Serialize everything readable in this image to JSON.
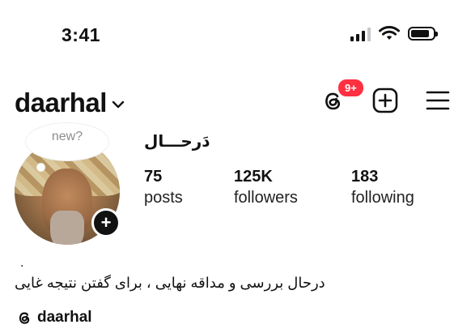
{
  "status_bar": {
    "time": "3:41",
    "icons": [
      "cellular-signal-icon",
      "wifi-icon",
      "battery-icon"
    ]
  },
  "header": {
    "username": "daarhal",
    "threads_badge": "9+",
    "icons": [
      "threads-icon",
      "add-post-icon",
      "menu-icon"
    ],
    "badge_color": "#ff3040"
  },
  "profile": {
    "note": "new?",
    "display_name": "دَرحـــال",
    "stats": [
      {
        "value": "75",
        "label": "posts"
      },
      {
        "value": "125K",
        "label": "followers"
      },
      {
        "value": "183",
        "label": "following"
      }
    ],
    "bio_dot": ".",
    "bio": "درحال بررسی و مداقه نهایی ، برای گفتن نتیجه غایی",
    "threads_link": "daarhal"
  }
}
